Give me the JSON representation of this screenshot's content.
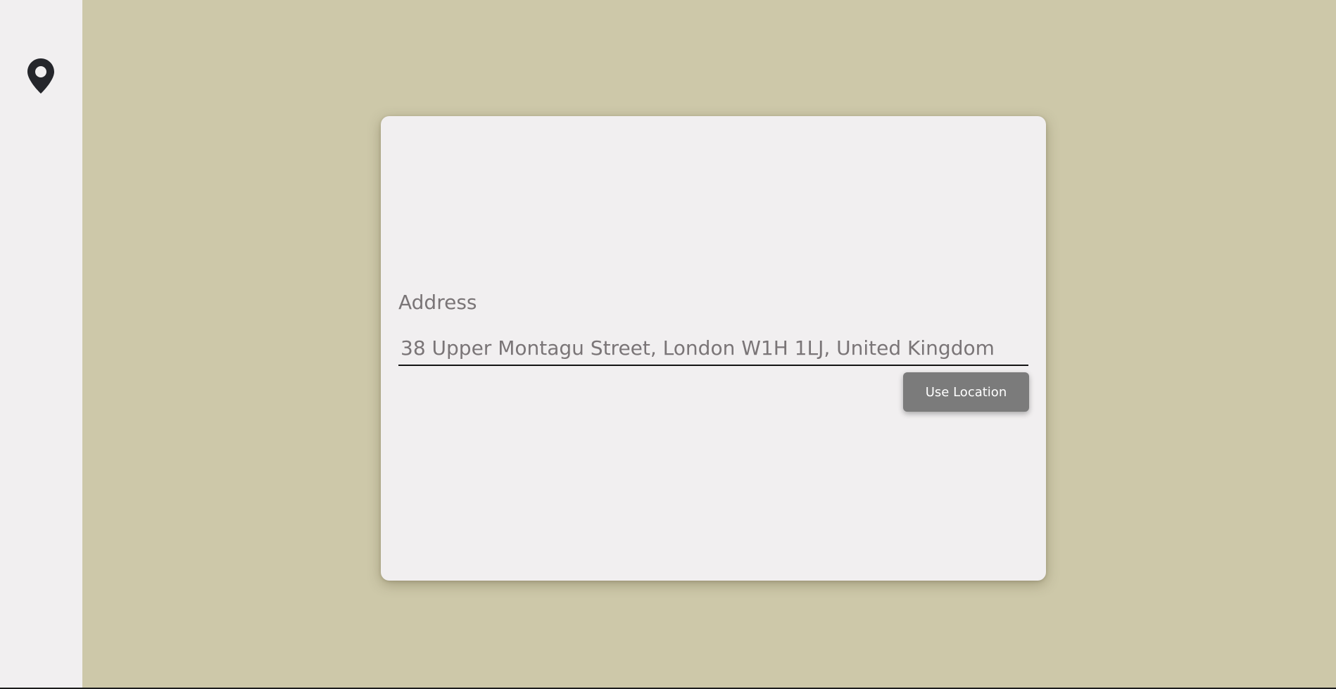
{
  "sidebar": {
    "icon": "map-pin-icon"
  },
  "form": {
    "address_label": "Address",
    "address_value": "38 Upper Montagu Street, London W1H 1LJ, United Kingdom",
    "use_location_label": "Use Location"
  },
  "colors": {
    "background": "#cdc8a9",
    "panel": "#f1eff0",
    "button": "#7b7b7b",
    "text_muted": "#7a7577"
  }
}
